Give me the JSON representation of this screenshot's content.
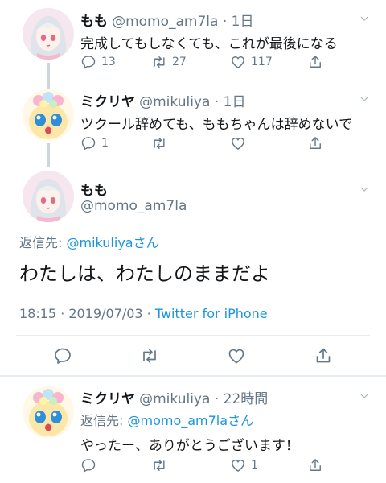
{
  "tweets": [
    {
      "name": "もも",
      "handle": "@momo_am7la",
      "time": "1日",
      "text": "完成してもしなくても、これが最後になる",
      "replies": "13",
      "retweets": "27",
      "likes": "117"
    },
    {
      "name": "ミクリヤ",
      "handle": "@mikuliya",
      "time": "1日",
      "text": "ツクール辞めても、ももちゃんは辞めないで",
      "replies": "1",
      "retweets": "",
      "likes": ""
    }
  ],
  "focus": {
    "name": "もも",
    "handle": "@momo_am7la",
    "reply_to_label": "返信先: ",
    "reply_to_handle": "@mikuliya",
    "reply_to_suffix": "さん",
    "text": "わたしは、わたしのままだよ",
    "timestamp": "18:15 · 2019/07/03 · ",
    "client": "Twitter for iPhone"
  },
  "reply": {
    "name": "ミクリヤ",
    "handle": "@mikuliya",
    "time": "22時間",
    "reply_to_label": "返信先: ",
    "reply_to_handle": "@momo_am7la",
    "reply_to_suffix": "さん",
    "text": "やったー、ありがとうございます！",
    "likes": "1"
  },
  "separator": " · ",
  "colors": {
    "accent": "#1b95e0",
    "muted": "#657786",
    "text": "#14171a",
    "line": "#ccd6dd"
  },
  "icons": [
    "reply-icon",
    "retweet-icon",
    "like-icon",
    "share-icon",
    "chevron-down-icon"
  ]
}
